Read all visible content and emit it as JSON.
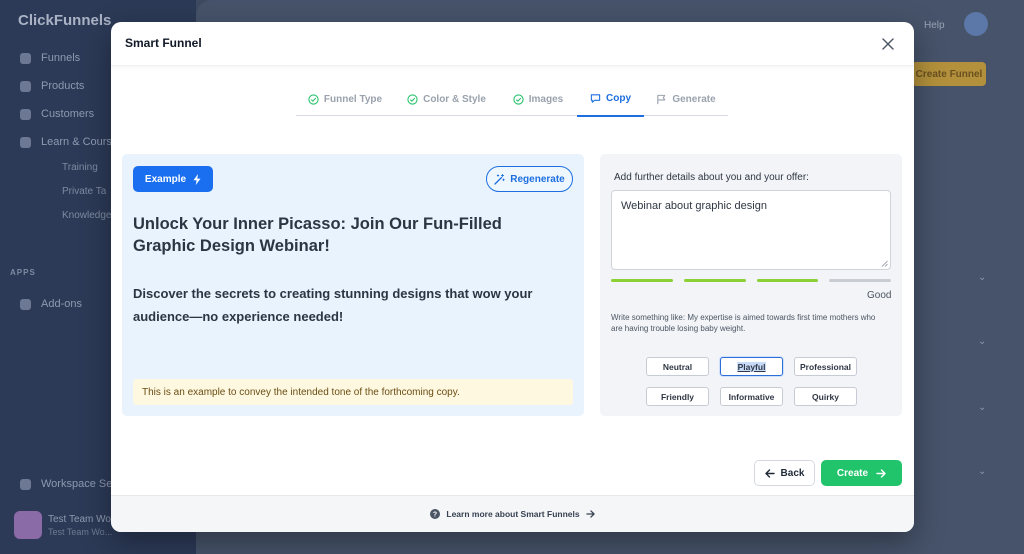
{
  "background": {
    "logo": "ClickFunnels",
    "nav": [
      "Funnels",
      "Products",
      "Customers",
      "Learn & Courses"
    ],
    "subnav": [
      "Training",
      "Private Ta",
      "Knowledge"
    ],
    "section": "APPS",
    "app_item": "Add-ons",
    "bottom_item": "Workspace Settings",
    "user_name": "Test Team Wo",
    "user_sub": "Test Team Wo...",
    "header_help": "Help",
    "header_button": "Create Funnel"
  },
  "modal": {
    "title": "Smart Funnel",
    "close_icon": "close-icon"
  },
  "steps": [
    {
      "label": "Funnel Type",
      "icon": "check-circle-icon",
      "state": "done"
    },
    {
      "label": "Color & Style",
      "icon": "check-circle-icon",
      "state": "done"
    },
    {
      "label": "Images",
      "icon": "check-circle-icon",
      "state": "done"
    },
    {
      "label": "Copy",
      "icon": "chat-icon",
      "state": "active"
    },
    {
      "label": "Generate",
      "icon": "flag-icon",
      "state": "pending"
    }
  ],
  "example": {
    "button_label": "Example",
    "regenerate_label": "Regenerate",
    "headline": "Unlock Your Inner Picasso: Join Our Fun-Filled Graphic Design Webinar!",
    "subheadline": "Discover the secrets to creating stunning designs that wow your audience—no experience needed!",
    "note": "This is an example to convey the intended tone of the forthcoming copy."
  },
  "details": {
    "label": "Add further details about you and your offer:",
    "value": "Webinar about graphic design",
    "strength_label": "Good",
    "strength_segments": 4,
    "strength_filled": 3,
    "hint": "Write something like: My expertise is aimed towards first time mothers who are having trouble losing baby weight.",
    "tones": [
      "Neutral",
      "Playful",
      "Professional",
      "Friendly",
      "Informative",
      "Quirky"
    ],
    "selected_tone": "Playful"
  },
  "actions": {
    "back_label": "Back",
    "create_label": "Create"
  },
  "footer": {
    "learn_more": "Learn more about Smart Funnels"
  },
  "colors": {
    "primary": "#1a6ff0",
    "success": "#21c36b",
    "strength_fill": "#8bd136",
    "strength_empty": "#c8ccd3",
    "step_done": "#27c26c"
  }
}
